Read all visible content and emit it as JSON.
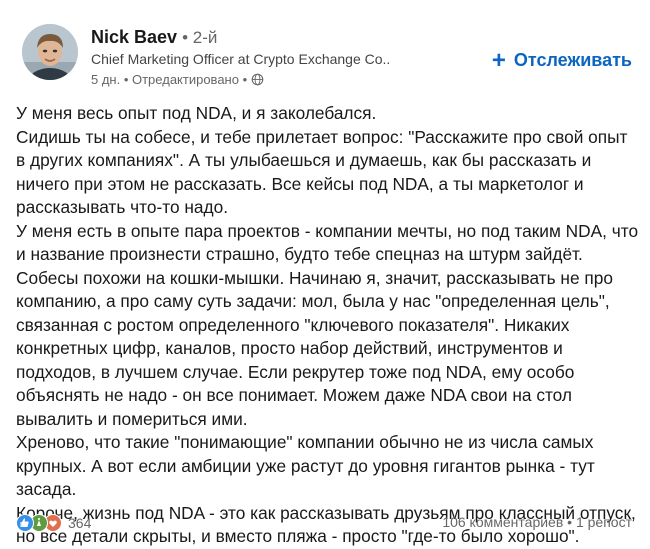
{
  "author": {
    "name": "Nick Baev",
    "degree": "• 2-й",
    "title": "Chief Marketing Officer at Crypto Exchange Co...",
    "meta": "5 дн. • Отредактировано •"
  },
  "follow_label": "Отслеживать",
  "post_lines": [
    "У меня весь опыт под NDA, и я заколебался.",
    "Сидишь ты на собесе, и тебе прилетает вопрос: \"Расскажите про свой опыт в других компаниях\". А ты улыбаешься и думаешь, как бы рассказать и ничего при этом не рассказать. Все кейсы под NDA, а ты маркетолог и рассказывать что-то надо.",
    "У меня есть в опыте пара проектов - компании мечты, но под таким NDA, что и название произнести страшно, будто тебе спецназ на штурм зайдёт. Собесы похожи на кошки-мышки. Начинаю я, значит, рассказывать не про компанию, а про саму суть задачи: мол, была у нас \"определенная цель\", связанная с ростом определенного \"ключевого показателя\". Никаких конкретных цифр, каналов, просто набор действий, инструментов и подходов, в лучшем случае. Если рекрутер тоже под NDA, ему особо объяснять не надо - он все понимает. Можем даже NDA свои на стол вывалить и помериться ими.",
    "Хреново, что такие \"понимающие\" компании обычно не из числа самых крупных. А вот если амбиции уже растут до уровня гигантов рынка - тут засада.",
    "Короче, жизнь под NDA - это как рассказывать друзьям про классный отпуск, но все детали скрыты, и вместо пляжа - просто \"где-то было хорошо\"."
  ],
  "reactions": {
    "count": "364",
    "icons": [
      "like-icon",
      "celebrate-icon",
      "support-icon"
    ],
    "colors": [
      "#378fe9",
      "#5f9b41",
      "#df704d"
    ]
  },
  "stats": {
    "comments": "106 комментариев",
    "separator": "•",
    "reposts": "1 репост"
  },
  "colors": {
    "accent": "#0a66c2",
    "text": "#191919",
    "secondary": "#666666"
  }
}
